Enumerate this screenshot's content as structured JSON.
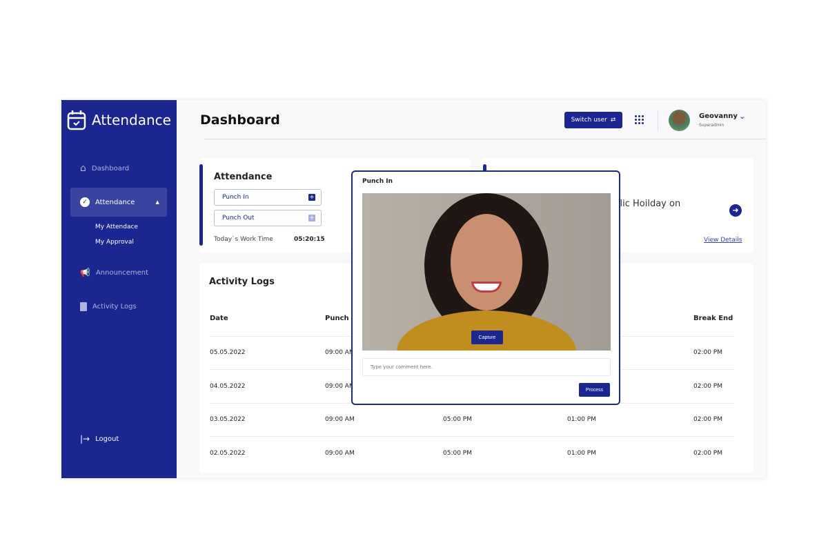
{
  "sidebar": {
    "brand": "Attendance",
    "items": [
      {
        "label": "Dashboard",
        "icon": "home-icon"
      },
      {
        "label": "Attendance",
        "icon": "check-circle-icon"
      },
      {
        "label": "Announcement",
        "icon": "megaphone-icon"
      },
      {
        "label": "Activity Logs",
        "icon": "report-icon"
      }
    ],
    "subitems": [
      "My Attendace",
      "My Approval"
    ],
    "logout": "Logout"
  },
  "header": {
    "title": "Dashboard",
    "switch_user": "Switch user",
    "user_name": "Geovanny",
    "user_role": "Superadmin"
  },
  "attendance_card": {
    "title": "Attendance",
    "punch_in": "Punch In",
    "punch_out": "Punch Out",
    "work_time_label": "Today`s Work Time",
    "work_time": "05:20:15"
  },
  "holiday_card": {
    "text": "ublic Hoilday on",
    "link": "View Details"
  },
  "activity": {
    "title": "Activity Logs",
    "headers": [
      "Date",
      "Punch In",
      "",
      "",
      "Break End"
    ],
    "rows": [
      [
        "05.05.2022",
        "09:00 AM",
        "",
        "",
        "02:00 PM"
      ],
      [
        "04.05.2022",
        "09:00 AM",
        "",
        "",
        "02:00 PM"
      ],
      [
        "03.05.2022",
        "09:00 AM",
        "05:00 PM",
        "01:00 PM",
        "02:00 PM"
      ],
      [
        "02.05.2022",
        "09:00 AM",
        "05:00 PM",
        "01:00 PM",
        "02:00 PM"
      ]
    ]
  },
  "modal": {
    "title": "Punch In",
    "capture": "Capture",
    "comment_placeholder": "Type your comment here.",
    "process": "Process"
  },
  "colors": {
    "primary": "#1b2690"
  }
}
